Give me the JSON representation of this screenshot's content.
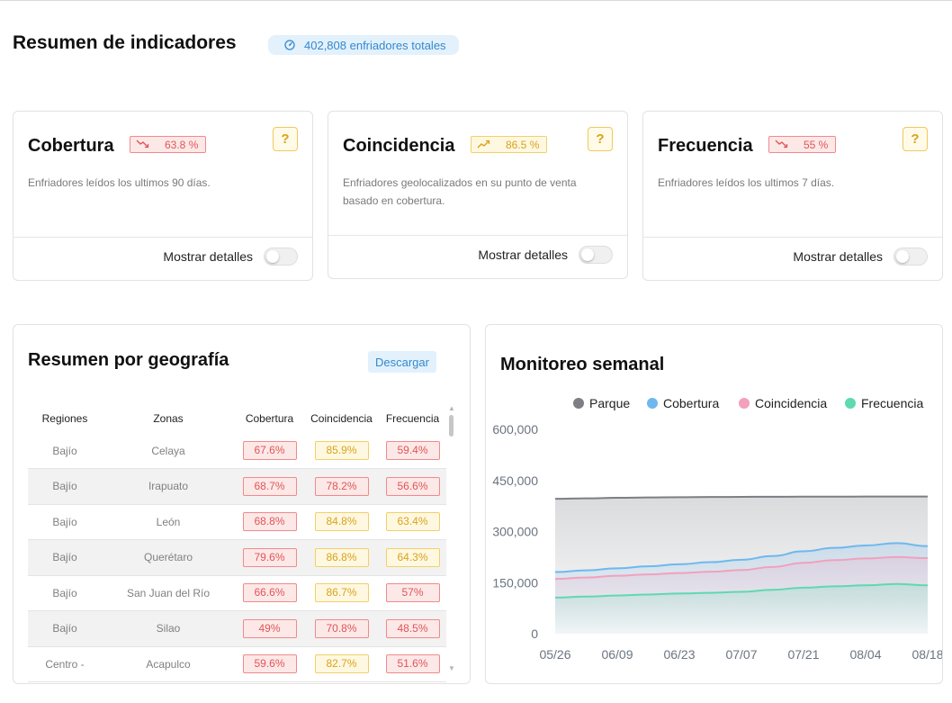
{
  "header": {
    "title": "Resumen de indicadores",
    "total_pill": "402,808 enfriadores totales",
    "total_icon": "gauge-icon"
  },
  "kpis": [
    {
      "title": "Cobertura",
      "value": "63.8 %",
      "trend": "down",
      "status_color": "#e05555",
      "description": "Enfriadores leídos los ultimos 90 días.",
      "help": "?",
      "toggle_label": "Mostrar detalles",
      "toggle_on": false
    },
    {
      "title": "Coincidencia",
      "value": "86.5 %",
      "trend": "up",
      "status_color": "#d9a21b",
      "description": "Enfriadores geolocalizados en su punto de venta basado en cobertura.",
      "help": "?",
      "toggle_label": "Mostrar detalles",
      "toggle_on": false
    },
    {
      "title": "Frecuencia",
      "value": "55 %",
      "trend": "down",
      "status_color": "#e05555",
      "description": "Enfriadores leídos los ultimos 7 días.",
      "help": "?",
      "toggle_label": "Mostrar detalles",
      "toggle_on": false
    }
  ],
  "geo": {
    "title": "Resumen por geografía",
    "download_label": "Descargar",
    "columns": [
      "Regiones",
      "Zonas",
      "Cobertura",
      "Coincidencia",
      "Frecuencia"
    ],
    "rows": [
      {
        "region": "Bajío",
        "zone": "Celaya",
        "cobertura": "67.6%",
        "coincidencia": "85.9%",
        "frecuencia": "59.4%",
        "colors": [
          "red",
          "yellow",
          "red"
        ]
      },
      {
        "region": "Bajío",
        "zone": "Irapuato",
        "cobertura": "68.7%",
        "coincidencia": "78.2%",
        "frecuencia": "56.6%",
        "colors": [
          "red",
          "red",
          "red"
        ]
      },
      {
        "region": "Bajío",
        "zone": "León",
        "cobertura": "68.8%",
        "coincidencia": "84.8%",
        "frecuencia": "63.4%",
        "colors": [
          "red",
          "yellow",
          "yellow"
        ]
      },
      {
        "region": "Bajío",
        "zone": "Querétaro",
        "cobertura": "79.6%",
        "coincidencia": "86.8%",
        "frecuencia": "64.3%",
        "colors": [
          "red",
          "yellow",
          "yellow"
        ]
      },
      {
        "region": "Bajío",
        "zone": "San Juan del Río",
        "cobertura": "66.6%",
        "coincidencia": "86.7%",
        "frecuencia": "57%",
        "colors": [
          "red",
          "yellow",
          "red"
        ]
      },
      {
        "region": "Bajío",
        "zone": "Silao",
        "cobertura": "49%",
        "coincidencia": "70.8%",
        "frecuencia": "48.5%",
        "colors": [
          "red",
          "red",
          "red"
        ]
      },
      {
        "region": "Centro -",
        "zone": "Acapulco",
        "cobertura": "59.6%",
        "coincidencia": "82.7%",
        "frecuencia": "51.6%",
        "colors": [
          "red",
          "yellow",
          "red"
        ]
      }
    ]
  },
  "monitor": {
    "title": "Monitoreo semanal"
  },
  "chart_data": {
    "type": "area",
    "title": "Monitoreo semanal",
    "x": [
      "05/26",
      "06/02",
      "06/09",
      "06/16",
      "06/23",
      "06/30",
      "07/07",
      "07/14",
      "07/21",
      "07/28",
      "08/04",
      "08/11",
      "08/18"
    ],
    "tick_labels": [
      "05/26",
      "06/09",
      "06/23",
      "07/07",
      "07/21",
      "08/04",
      "08/18"
    ],
    "ylim": [
      0,
      600000
    ],
    "yticks": [
      "600,000",
      "450,000",
      "300,000",
      "150,000",
      "0"
    ],
    "ytick_values": [
      600000,
      450000,
      300000,
      150000,
      0
    ],
    "legend_position": "top",
    "series": [
      {
        "name": "Parque",
        "color": "#7d7f85",
        "values": [
          396000,
          397500,
          399000,
          400000,
          400800,
          401300,
          401800,
          402100,
          402300,
          402500,
          402600,
          402700,
          402808
        ]
      },
      {
        "name": "Cobertura",
        "color": "#6eb8ef",
        "values": [
          181000,
          186000,
          192000,
          198000,
          204000,
          210000,
          217000,
          228000,
          242000,
          252000,
          259000,
          266000,
          257000
        ]
      },
      {
        "name": "Coincidencia",
        "color": "#f2a0bd",
        "values": [
          161000,
          165000,
          170000,
          174000,
          178000,
          182000,
          187000,
          196000,
          208000,
          216000,
          221000,
          225000,
          222000
        ]
      },
      {
        "name": "Frecuencia",
        "color": "#5ed9b0",
        "values": [
          106000,
          109000,
          112000,
          115000,
          118000,
          120000,
          123000,
          129000,
          135000,
          139000,
          142000,
          146000,
          142000
        ]
      }
    ]
  }
}
